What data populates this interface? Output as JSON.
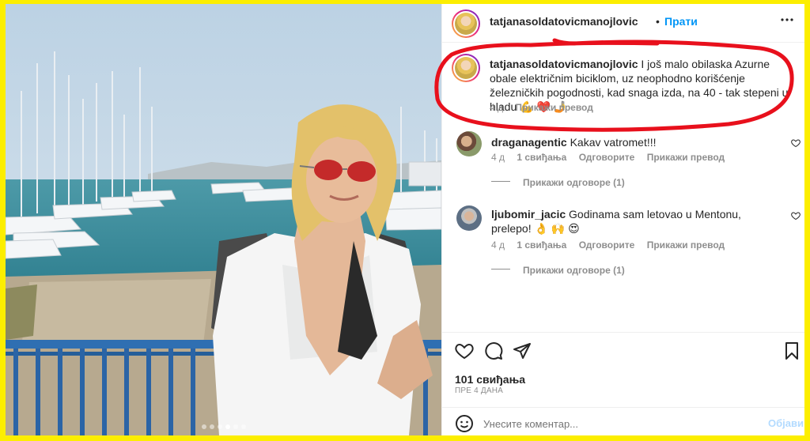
{
  "post": {
    "username": "tatjanasoldatovicmanojlovic",
    "follow_label": "Прати",
    "caption": "I još malo obilaska Azurne obale električnim biciklom, uz neophodno korišćenje železničkih pogodnosti, kad snaga izda, na 40 - tak stepeni u hladu 💪 ❤️ 🤳",
    "caption_time": "4 д",
    "caption_translate": "Прикажи превод"
  },
  "comments": [
    {
      "username": "draganagentic",
      "text": "Kakav vatromet!!!",
      "time": "4 д",
      "likes": "1 свиђања",
      "reply": "Одговорите",
      "translate": "Прикажи превод",
      "view_replies": "Прикажи одговоре (1)"
    },
    {
      "username": "ljubomir_jacic",
      "text": "Godinama sam letovao u Mentonu, prelepo! 👌 🙌 😍",
      "time": "4 д",
      "likes": "1 свиђања",
      "reply": "Одговорите",
      "translate": "Прикажи превод",
      "view_replies": "Прикажи одговоре (1)"
    }
  ],
  "footer": {
    "likes": "101 свиђања",
    "date": "ПРЕ 4 ДАНА",
    "comment_placeholder": "Унесите коментар...",
    "post_label": "Објави"
  },
  "icons": [
    "more-icon",
    "heart-icon",
    "comment-icon",
    "share-icon",
    "bookmark-icon",
    "emoji-icon"
  ],
  "colors": {
    "frame": "#fcee00",
    "link": "#0095f6",
    "annotation": "#e8101c"
  }
}
